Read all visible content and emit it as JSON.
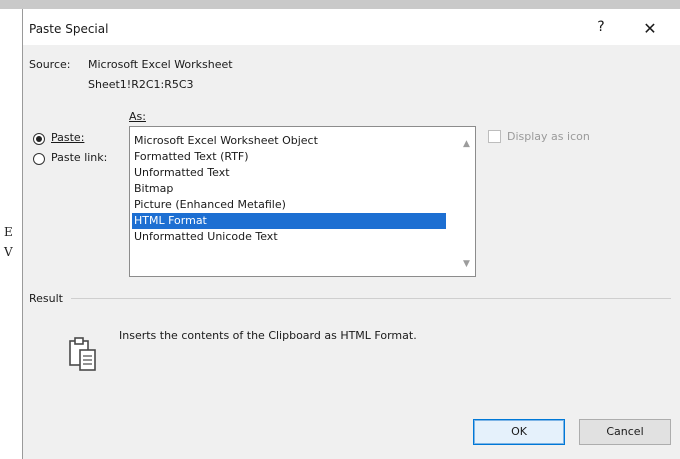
{
  "dialog": {
    "title": "Paste Special",
    "help_label": "?",
    "close_label": "✕"
  },
  "source": {
    "label": "Source:",
    "name": "Microsoft Excel Worksheet",
    "range": "Sheet1!R2C1:R5C3"
  },
  "paste_as_label": "As:",
  "options": {
    "paste_label": "Paste:",
    "paste_link_label": "Paste link:",
    "selected": "paste"
  },
  "format_list": {
    "items": [
      "Microsoft Excel Worksheet Object",
      "Formatted Text (RTF)",
      "Unformatted Text",
      "Bitmap",
      "Picture (Enhanced Metafile)",
      "HTML Format",
      "Unformatted Unicode Text"
    ],
    "selected_index": 5,
    "scroll_up_icon": "chevron-up-icon",
    "scroll_down_icon": "chevron-down-icon"
  },
  "display_as_icon_label": "Display as icon",
  "result": {
    "label": "Result",
    "description": "Inserts the contents of the Clipboard as HTML Format.",
    "icon": "clipboard-icon"
  },
  "buttons": {
    "ok_label": "OK",
    "cancel_label": "Cancel"
  },
  "background_fragments": [
    "E",
    "V"
  ],
  "colors": {
    "selection": "#1d6fd2",
    "dialog_bg": "#f0f0f0",
    "ok_border": "#0078d7"
  }
}
